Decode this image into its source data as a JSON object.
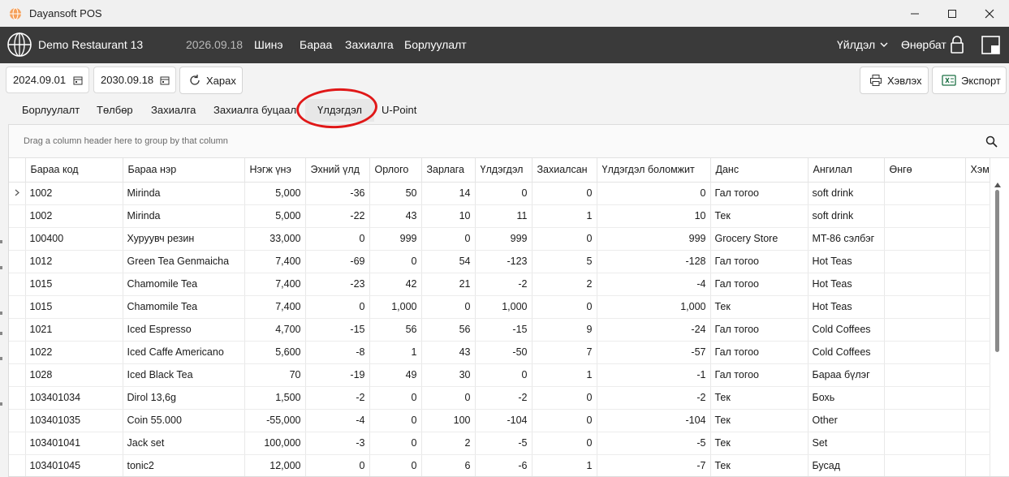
{
  "window": {
    "title": "Dayansoft POS"
  },
  "topbar": {
    "restaurant": "Demo Restaurant 13",
    "date": "2026.09.18",
    "menu": [
      "Шинэ",
      "Бараа",
      "Захиалга",
      "Борлуулалт"
    ],
    "reports_label": "Үйлдэл",
    "user": "Өнөрбат"
  },
  "toolbar": {
    "date_from": "2024.09.01",
    "date_to": "2030.09.18",
    "view_label": "Харах",
    "print_label": "Хэвлэх",
    "export_label": "Экспорт"
  },
  "tabs": [
    "Борлуулалт",
    "Төлбөр",
    "Захиалга",
    "Захиалга буцаалт",
    "Үлдэгдэл",
    "U-Point"
  ],
  "active_tab": "Үлдэгдэл",
  "grid": {
    "group_hint": "Drag a column header here to group by that column",
    "columns": [
      "Бараа код",
      "Бараа нэр",
      "Нэгж үнэ",
      "Эхний үлд",
      "Орлого",
      "Зарлага",
      "Үлдэгдэл",
      "Захиалсан",
      "Үлдэгдэл боломжит",
      "Данс",
      "Ангилал",
      "Өнгө",
      "Хэм"
    ],
    "rows": [
      [
        "1002",
        "Mirinda",
        "5,000",
        "-36",
        "50",
        "14",
        "0",
        "0",
        "0",
        "Гал тогоо",
        "soft drink"
      ],
      [
        "1002",
        "Mirinda",
        "5,000",
        "-22",
        "43",
        "10",
        "11",
        "1",
        "10",
        "Тек",
        "soft drink"
      ],
      [
        "100400",
        "Хуруувч резин",
        "33,000",
        "0",
        "999",
        "0",
        "999",
        "0",
        "999",
        "Grocery Store",
        "MT-86 сэлбэг"
      ],
      [
        "1012",
        "Green Tea Genmaicha",
        "7,400",
        "-69",
        "0",
        "54",
        "-123",
        "5",
        "-128",
        "Гал тогоо",
        "Hot Teas"
      ],
      [
        "1015",
        "Chamomile Tea",
        "7,400",
        "-23",
        "42",
        "21",
        "-2",
        "2",
        "-4",
        "Гал тогоо",
        "Hot Teas"
      ],
      [
        "1015",
        "Chamomile Tea",
        "7,400",
        "0",
        "1,000",
        "0",
        "1,000",
        "0",
        "1,000",
        "Тек",
        "Hot Teas"
      ],
      [
        "1021",
        "Iced Espresso",
        "4,700",
        "-15",
        "56",
        "56",
        "-15",
        "9",
        "-24",
        "Гал тогоо",
        "Cold Coffees"
      ],
      [
        "1022",
        "Iced Caffe Americano",
        "5,600",
        "-8",
        "1",
        "43",
        "-50",
        "7",
        "-57",
        "Гал тогоо",
        "Cold Coffees"
      ],
      [
        "1028",
        "Iced Black Tea",
        "70",
        "-19",
        "49",
        "30",
        "0",
        "1",
        "-1",
        "Гал тогоо",
        "Бараа бүлэг"
      ],
      [
        "103401034",
        "Dirol 13,6g",
        "1,500",
        "-2",
        "0",
        "0",
        "-2",
        "0",
        "-2",
        "Тек",
        "Бохь"
      ],
      [
        "103401035",
        "Coin 55.000",
        "-55,000",
        "-4",
        "0",
        "100",
        "-104",
        "0",
        "-104",
        "Тек",
        "Other"
      ],
      [
        "103401041",
        "Jack set",
        "100,000",
        "-3",
        "0",
        "2",
        "-5",
        "0",
        "-5",
        "Тек",
        "Set"
      ],
      [
        "103401045",
        "tonic2",
        "12,000",
        "0",
        "0",
        "6",
        "-6",
        "1",
        "-7",
        "Тек",
        "Бусад"
      ]
    ]
  }
}
